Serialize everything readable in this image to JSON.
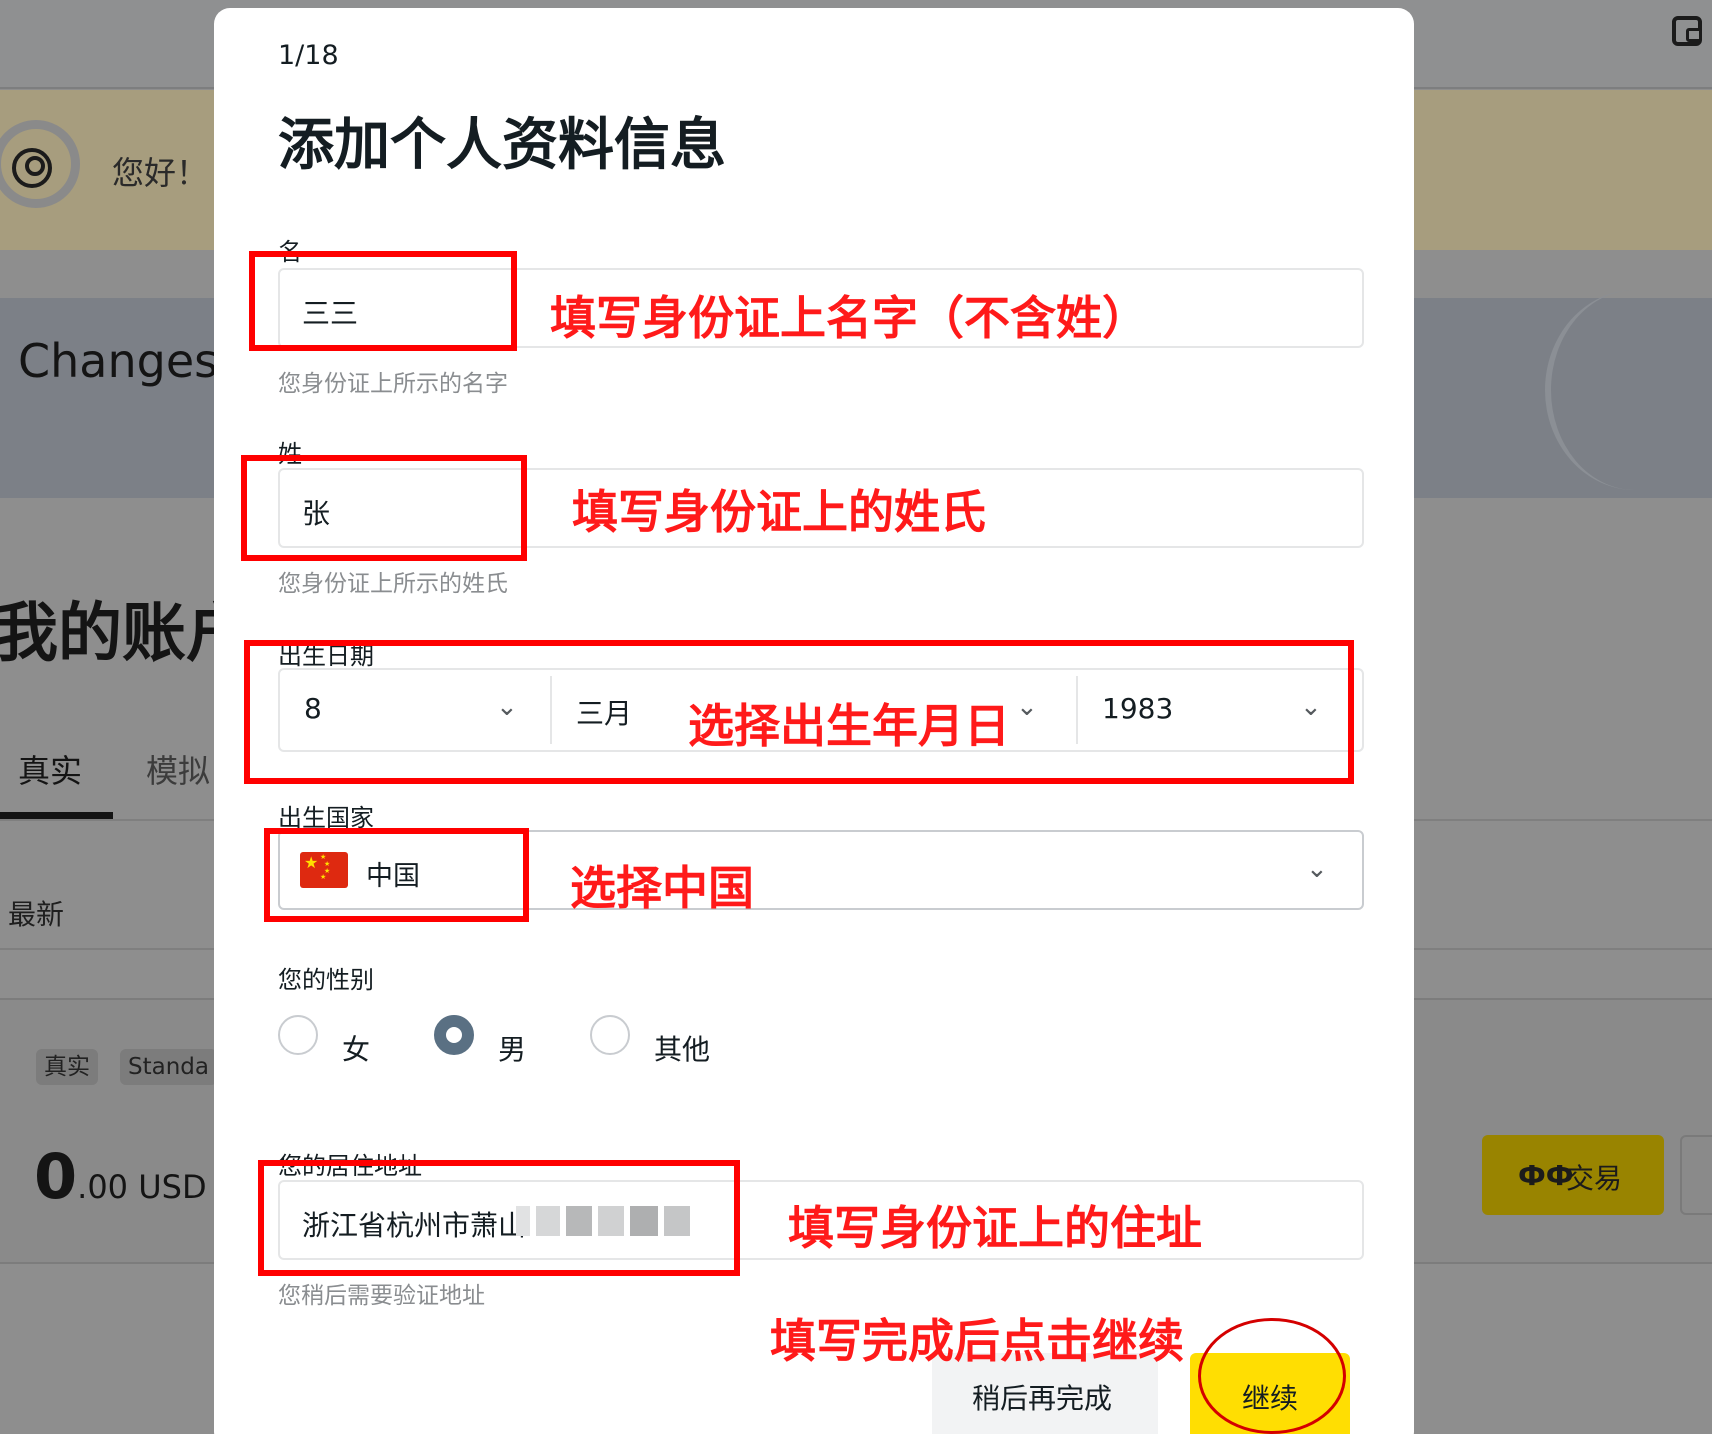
{
  "background": {
    "greeting": "您好！",
    "changes_text": "Changes",
    "account_title": "我的账户",
    "tabs": [
      "真实",
      "模拟"
    ],
    "latest": "最新",
    "badges": [
      "真实",
      "Standa"
    ],
    "balance_int": "0",
    "balance_frac": ".00 USD",
    "trade_label": "交易"
  },
  "modal": {
    "step": "1/18",
    "title": "添加个人资料信息",
    "first_name": {
      "label": "名",
      "value": "三三",
      "hint": "您身份证上所示的名字"
    },
    "last_name": {
      "label": "姓",
      "value": "张",
      "hint": "您身份证上所示的姓氏"
    },
    "dob": {
      "label": "出生日期",
      "day": "8",
      "month": "三月",
      "year": "1983"
    },
    "country": {
      "label": "出生国家",
      "value": "中国"
    },
    "gender": {
      "label": "您的性别",
      "options": [
        "女",
        "男",
        "其他"
      ],
      "selected": "男"
    },
    "address": {
      "label": "您的居住地址",
      "value": "浙江省杭州市萧山",
      "hint": "您稍后需要验证地址"
    },
    "buttons": {
      "later": "稍后再完成",
      "continue": "继续"
    }
  },
  "annotations": {
    "first_name": "填写身份证上名字（不含姓）",
    "last_name": "填写身份证上的姓氏",
    "dob": "选择出生年月日",
    "country": "选择中国",
    "address": "填写身份证上的住址",
    "continue": "填写完成后点击继续",
    "color": "#ff0000"
  }
}
